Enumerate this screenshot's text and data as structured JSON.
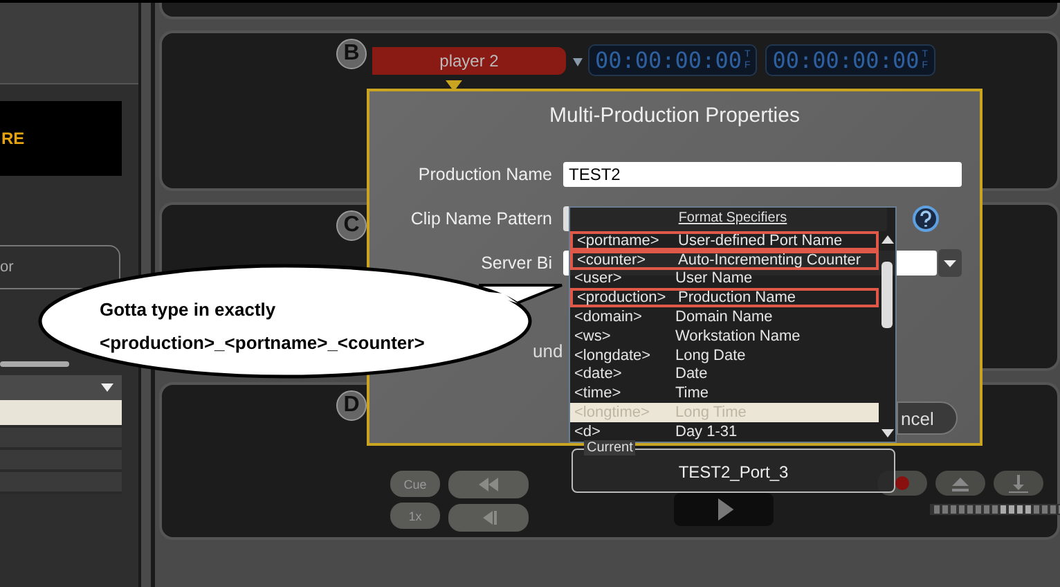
{
  "sidebar": {
    "banner_text": "RE",
    "field_text": "or",
    "list_rows": [
      {
        "selected": true
      },
      {
        "selected": false
      },
      {
        "selected": false
      },
      {
        "selected": false
      }
    ]
  },
  "players": [
    {
      "badge": "B",
      "name": "player 2",
      "timecodes": [
        {
          "value": "00:00:00:00",
          "flags": [
            "T",
            "F"
          ]
        },
        {
          "value": "00:00:00:00",
          "flags": [
            "T",
            "F"
          ]
        }
      ]
    },
    {
      "badge": "C"
    },
    {
      "badge": "D",
      "transport_buttons": [
        "Cue",
        "1x"
      ]
    }
  ],
  "dialog": {
    "title": "Multi-Production Properties",
    "production_name": {
      "label": "Production Name",
      "value": "TEST2"
    },
    "clip_name_pattern": {
      "label": "Clip Name Pattern"
    },
    "server_label": "Server Bi",
    "option_label": "und",
    "cancel_button": "ncel",
    "format_specifiers": {
      "title": "Format Specifiers",
      "items": [
        {
          "code": "<portname>",
          "description": "User-defined Port Name",
          "selected": false,
          "highlighted": true
        },
        {
          "code": "<counter>",
          "description": "Auto-Incrementing Counter",
          "selected": false,
          "highlighted": true
        },
        {
          "code": "<user>",
          "description": "User Name",
          "selected": false,
          "highlighted": false
        },
        {
          "code": "<production>",
          "description": "Production Name",
          "selected": false,
          "highlighted": true
        },
        {
          "code": "<domain>",
          "description": "Domain Name",
          "selected": false,
          "highlighted": false
        },
        {
          "code": "<ws>",
          "description": "Workstation Name",
          "selected": false,
          "highlighted": false
        },
        {
          "code": "<longdate>",
          "description": "Long Date",
          "selected": false,
          "highlighted": false
        },
        {
          "code": "<date>",
          "description": "Date",
          "selected": false,
          "highlighted": false
        },
        {
          "code": "<time>",
          "description": "Time",
          "selected": false,
          "highlighted": false
        },
        {
          "code": "<longtime>",
          "description": "Long Time",
          "selected": true,
          "highlighted": false
        },
        {
          "code": "<d>",
          "description": "Day 1-31",
          "selected": false,
          "highlighted": false
        }
      ],
      "current": {
        "label": "Current",
        "value": "TEST2_Port_3"
      }
    }
  },
  "annotation": {
    "lines": [
      "Gotta type in exactly",
      "<production>_<portname>_<counter>"
    ]
  }
}
